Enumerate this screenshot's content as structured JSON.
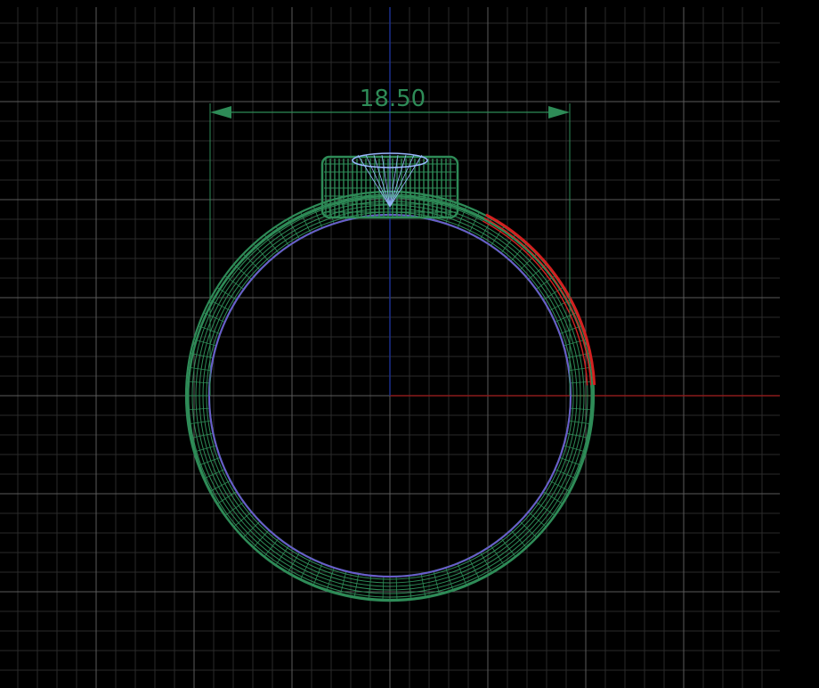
{
  "viewport": {
    "background_color": "#000000",
    "grid_major_color": "#5a5a5a",
    "grid_minor_color": "#2a2a2a",
    "x_axis_color": "#8b1a1a",
    "y_axis_color": "#1a2f8b"
  },
  "dimension": {
    "value": "18.50",
    "color": "#2e8b57"
  },
  "model": {
    "name_icon": "ring-wireframe-icon",
    "shank_color": "#2e8b57",
    "inner_edge_color": "#6a5acd",
    "selected_color": "#d42020",
    "stone_color": "#9ab7ff"
  }
}
